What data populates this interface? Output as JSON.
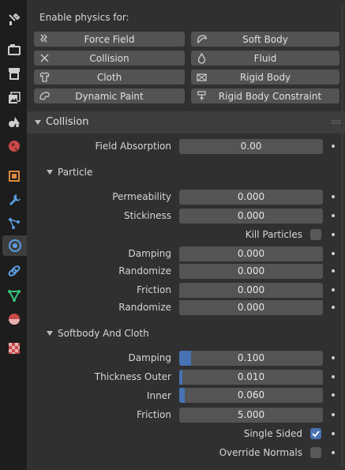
{
  "tabs": [
    {
      "icon": "tool-icon"
    },
    {
      "icon": "render-icon"
    },
    {
      "icon": "output-icon"
    },
    {
      "icon": "view-layer-icon"
    },
    {
      "icon": "scene-icon"
    },
    {
      "icon": "world-icon"
    },
    {
      "icon": "object-icon"
    },
    {
      "icon": "modifier-icon"
    },
    {
      "icon": "particles-icon"
    },
    {
      "icon": "physics-icon",
      "active": true
    },
    {
      "icon": "constraints-icon"
    },
    {
      "icon": "data-icon"
    },
    {
      "icon": "material-icon"
    },
    {
      "icon": "texture-icon"
    }
  ],
  "enable_label": "Enable physics for:",
  "physics_buttons": {
    "force_field": "Force Field",
    "soft_body": "Soft Body",
    "collision": "Collision",
    "fluid": "Fluid",
    "cloth": "Cloth",
    "rigid_body": "Rigid Body",
    "dynamic_paint": "Dynamic Paint",
    "rigid_body_constraint": "Rigid Body Constraint"
  },
  "collision": {
    "title": "Collision",
    "field_absorption": {
      "label": "Field Absorption",
      "value": "0.00"
    },
    "particle": {
      "title": "Particle",
      "permeability": {
        "label": "Permeability",
        "value": "0.000"
      },
      "stickiness": {
        "label": "Stickiness",
        "value": "0.000"
      },
      "kill_particles": {
        "label": "Kill Particles",
        "checked": false
      },
      "damping": {
        "label": "Damping",
        "value": "0.000"
      },
      "damping_randomize": {
        "label": "Randomize",
        "value": "0.000"
      },
      "friction": {
        "label": "Friction",
        "value": "0.000"
      },
      "friction_randomize": {
        "label": "Randomize",
        "value": "0.000"
      }
    },
    "softbody_cloth": {
      "title": "Softbody And Cloth",
      "damping": {
        "label": "Damping",
        "value": "0.100",
        "fill": 0.08
      },
      "thickness_outer": {
        "label": "Thickness Outer",
        "value": "0.010",
        "fill": 0.01
      },
      "inner": {
        "label": "Inner",
        "value": "0.060",
        "fill": 0.04
      },
      "friction": {
        "label": "Friction",
        "value": "5.000"
      },
      "single_sided": {
        "label": "Single Sided",
        "checked": true
      },
      "override_normals": {
        "label": "Override Normals",
        "checked": false
      }
    }
  },
  "colors": {
    "accent": "#4772b3",
    "panel": "#303030",
    "tab_bar": "#1d1d1d",
    "field": "#545454"
  }
}
